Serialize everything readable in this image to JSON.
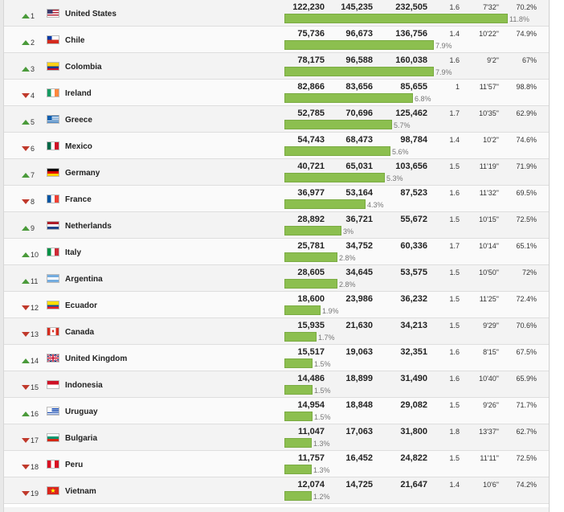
{
  "rows": [
    {
      "rank": "1",
      "trend": "up",
      "country": "United States",
      "flag": "flag-us",
      "a": "122,230",
      "b": "145,235",
      "c": "232,505",
      "d": "1.6",
      "e": "7'32\"",
      "f": "70.2%",
      "share": "11.8%",
      "share_value": 11.8
    },
    {
      "rank": "2",
      "trend": "up",
      "country": "Chile",
      "flag": "flag-chile",
      "a": "75,736",
      "b": "96,673",
      "c": "136,756",
      "d": "1.4",
      "e": "10'22\"",
      "f": "74.9%",
      "share": "7.9%",
      "share_value": 7.9
    },
    {
      "rank": "3",
      "trend": "up",
      "country": "Colombia",
      "flag": "flag-colombia",
      "a": "78,175",
      "b": "96,588",
      "c": "160,038",
      "d": "1.6",
      "e": "9'2\"",
      "f": "67%",
      "share": "7.9%",
      "share_value": 7.9
    },
    {
      "rank": "4",
      "trend": "down",
      "country": "Ireland",
      "flag": "flag-ireland",
      "a": "82,866",
      "b": "83,656",
      "c": "85,655",
      "d": "1",
      "e": "11'57\"",
      "f": "98.8%",
      "share": "6.8%",
      "share_value": 6.8
    },
    {
      "rank": "5",
      "trend": "up",
      "country": "Greece",
      "flag": "flag-greece",
      "a": "52,785",
      "b": "70,696",
      "c": "125,462",
      "d": "1.7",
      "e": "10'35\"",
      "f": "62.9%",
      "share": "5.7%",
      "share_value": 5.7
    },
    {
      "rank": "6",
      "trend": "down",
      "country": "Mexico",
      "flag": "flag-mexico",
      "a": "54,743",
      "b": "68,473",
      "c": "98,784",
      "d": "1.4",
      "e": "10'2\"",
      "f": "74.6%",
      "share": "5.6%",
      "share_value": 5.6
    },
    {
      "rank": "7",
      "trend": "up",
      "country": "Germany",
      "flag": "flag-germany",
      "a": "40,721",
      "b": "65,031",
      "c": "103,656",
      "d": "1.5",
      "e": "11'19\"",
      "f": "71.9%",
      "share": "5.3%",
      "share_value": 5.3
    },
    {
      "rank": "8",
      "trend": "down",
      "country": "France",
      "flag": "flag-france",
      "a": "36,977",
      "b": "53,164",
      "c": "87,523",
      "d": "1.6",
      "e": "11'32\"",
      "f": "69.5%",
      "share": "4.3%",
      "share_value": 4.3
    },
    {
      "rank": "9",
      "trend": "up",
      "country": "Netherlands",
      "flag": "flag-netherlands",
      "a": "28,892",
      "b": "36,721",
      "c": "55,672",
      "d": "1.5",
      "e": "10'15\"",
      "f": "72.5%",
      "share": "3%",
      "share_value": 3.0
    },
    {
      "rank": "10",
      "trend": "up",
      "country": "Italy",
      "flag": "flag-italy",
      "a": "25,781",
      "b": "34,752",
      "c": "60,336",
      "d": "1.7",
      "e": "10'14\"",
      "f": "65.1%",
      "share": "2.8%",
      "share_value": 2.8
    },
    {
      "rank": "11",
      "trend": "up",
      "country": "Argentina",
      "flag": "flag-argentina",
      "a": "28,605",
      "b": "34,645",
      "c": "53,575",
      "d": "1.5",
      "e": "10'50\"",
      "f": "72%",
      "share": "2.8%",
      "share_value": 2.8
    },
    {
      "rank": "12",
      "trend": "down",
      "country": "Ecuador",
      "flag": "flag-ecuador",
      "a": "18,600",
      "b": "23,986",
      "c": "36,232",
      "d": "1.5",
      "e": "11'25\"",
      "f": "72.4%",
      "share": "1.9%",
      "share_value": 1.9
    },
    {
      "rank": "13",
      "trend": "down",
      "country": "Canada",
      "flag": "flag-canada",
      "a": "15,935",
      "b": "21,630",
      "c": "34,213",
      "d": "1.5",
      "e": "9'29\"",
      "f": "70.6%",
      "share": "1.7%",
      "share_value": 1.7
    },
    {
      "rank": "14",
      "trend": "up",
      "country": "United Kingdom",
      "flag": "flag-uk",
      "a": "15,517",
      "b": "19,063",
      "c": "32,351",
      "d": "1.6",
      "e": "8'15\"",
      "f": "67.5%",
      "share": "1.5%",
      "share_value": 1.5
    },
    {
      "rank": "15",
      "trend": "down",
      "country": "Indonesia",
      "flag": "flag-indonesia",
      "a": "14,486",
      "b": "18,899",
      "c": "31,490",
      "d": "1.6",
      "e": "10'40\"",
      "f": "65.9%",
      "share": "1.5%",
      "share_value": 1.5
    },
    {
      "rank": "16",
      "trend": "up",
      "country": "Uruguay",
      "flag": "flag-uruguay",
      "a": "14,954",
      "b": "18,848",
      "c": "29,082",
      "d": "1.5",
      "e": "9'26\"",
      "f": "71.7%",
      "share": "1.5%",
      "share_value": 1.5
    },
    {
      "rank": "17",
      "trend": "down",
      "country": "Bulgaria",
      "flag": "flag-bulgaria",
      "a": "11,047",
      "b": "17,063",
      "c": "31,800",
      "d": "1.8",
      "e": "13'37\"",
      "f": "62.7%",
      "share": "1.3%",
      "share_value": 1.3
    },
    {
      "rank": "18",
      "trend": "down",
      "country": "Peru",
      "flag": "flag-peru",
      "a": "11,757",
      "b": "16,452",
      "c": "24,822",
      "d": "1.5",
      "e": "11'11\"",
      "f": "72.5%",
      "share": "1.3%",
      "share_value": 1.3
    },
    {
      "rank": "19",
      "trend": "down",
      "country": "Vietnam",
      "flag": "flag-vietnam",
      "a": "12,074",
      "b": "14,725",
      "c": "21,647",
      "d": "1.4",
      "e": "10'6\"",
      "f": "74.2%",
      "share": "1.2%",
      "share_value": 1.2
    }
  ],
  "colors": {
    "bar": "#8cbf4f",
    "up": "#4a9a3a",
    "down": "#c0392b"
  }
}
